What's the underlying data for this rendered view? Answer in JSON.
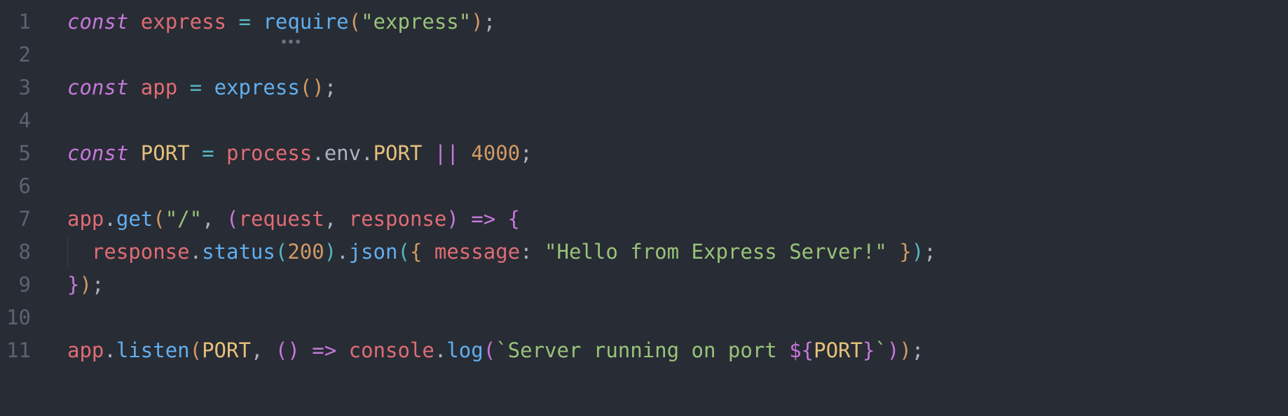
{
  "language": "javascript",
  "syntax_colors": {
    "keyword": "#c678dd",
    "identifier": "#e06c75",
    "definition": "#e5c07b",
    "function": "#61afef",
    "string": "#98c379",
    "number": "#d19a66",
    "operator": "#56b6c2",
    "default": "#abb2bf",
    "comment": "#5c6370",
    "background": "#282c34"
  },
  "gutter": {
    "lines": [
      "1",
      "2",
      "3",
      "4",
      "5",
      "6",
      "7",
      "8",
      "9",
      "10",
      "11"
    ]
  },
  "code": {
    "lines": [
      [
        {
          "cls": "kw-it",
          "t": "const"
        },
        {
          "cls": "plain",
          "t": " "
        },
        {
          "cls": "ident",
          "t": "express"
        },
        {
          "cls": "plain",
          "t": " "
        },
        {
          "cls": "op",
          "t": "="
        },
        {
          "cls": "plain",
          "t": " "
        },
        {
          "cls": "fn",
          "t": "require"
        },
        {
          "cls": "brY",
          "t": "("
        },
        {
          "cls": "str",
          "t": "\"express\""
        },
        {
          "cls": "brY",
          "t": ")"
        },
        {
          "cls": "plain",
          "t": ";"
        }
      ],
      [],
      [
        {
          "cls": "kw-it",
          "t": "const"
        },
        {
          "cls": "plain",
          "t": " "
        },
        {
          "cls": "ident",
          "t": "app"
        },
        {
          "cls": "plain",
          "t": " "
        },
        {
          "cls": "op",
          "t": "="
        },
        {
          "cls": "plain",
          "t": " "
        },
        {
          "cls": "fn",
          "t": "express"
        },
        {
          "cls": "brY",
          "t": "()"
        },
        {
          "cls": "plain",
          "t": ";"
        }
      ],
      [],
      [
        {
          "cls": "kw-it",
          "t": "const"
        },
        {
          "cls": "plain",
          "t": " "
        },
        {
          "cls": "def",
          "t": "PORT"
        },
        {
          "cls": "plain",
          "t": " "
        },
        {
          "cls": "op",
          "t": "="
        },
        {
          "cls": "plain",
          "t": " "
        },
        {
          "cls": "ident",
          "t": "process"
        },
        {
          "cls": "plain",
          "t": "."
        },
        {
          "cls": "prop",
          "t": "env"
        },
        {
          "cls": "plain",
          "t": "."
        },
        {
          "cls": "def",
          "t": "PORT"
        },
        {
          "cls": "plain",
          "t": " "
        },
        {
          "cls": "kw",
          "t": "||"
        },
        {
          "cls": "plain",
          "t": " "
        },
        {
          "cls": "num",
          "t": "4000"
        },
        {
          "cls": "plain",
          "t": ";"
        }
      ],
      [],
      [
        {
          "cls": "ident",
          "t": "app"
        },
        {
          "cls": "plain",
          "t": "."
        },
        {
          "cls": "fn",
          "t": "get"
        },
        {
          "cls": "brY",
          "t": "("
        },
        {
          "cls": "str",
          "t": "\"/\""
        },
        {
          "cls": "plain",
          "t": ", "
        },
        {
          "cls": "brP",
          "t": "("
        },
        {
          "cls": "ident",
          "t": "request"
        },
        {
          "cls": "plain",
          "t": ", "
        },
        {
          "cls": "ident",
          "t": "response"
        },
        {
          "cls": "brP",
          "t": ")"
        },
        {
          "cls": "plain",
          "t": " "
        },
        {
          "cls": "kw",
          "t": "=>"
        },
        {
          "cls": "plain",
          "t": " "
        },
        {
          "cls": "brP",
          "t": "{"
        }
      ],
      [
        {
          "cls": "plain",
          "t": "  "
        },
        {
          "cls": "ident",
          "t": "response"
        },
        {
          "cls": "plain",
          "t": "."
        },
        {
          "cls": "fn",
          "t": "status"
        },
        {
          "cls": "brB",
          "t": "("
        },
        {
          "cls": "num",
          "t": "200"
        },
        {
          "cls": "brB",
          "t": ")"
        },
        {
          "cls": "plain",
          "t": "."
        },
        {
          "cls": "fn",
          "t": "json"
        },
        {
          "cls": "brB",
          "t": "("
        },
        {
          "cls": "brY",
          "t": "{"
        },
        {
          "cls": "plain",
          "t": " "
        },
        {
          "cls": "ident",
          "t": "message"
        },
        {
          "cls": "plain",
          "t": ": "
        },
        {
          "cls": "str",
          "t": "\"Hello from Express Server!\""
        },
        {
          "cls": "plain",
          "t": " "
        },
        {
          "cls": "brY",
          "t": "}"
        },
        {
          "cls": "brB",
          "t": ")"
        },
        {
          "cls": "plain",
          "t": ";"
        }
      ],
      [
        {
          "cls": "brP",
          "t": "}"
        },
        {
          "cls": "brY",
          "t": ")"
        },
        {
          "cls": "plain",
          "t": ";"
        }
      ],
      [],
      [
        {
          "cls": "ident",
          "t": "app"
        },
        {
          "cls": "plain",
          "t": "."
        },
        {
          "cls": "fn",
          "t": "listen"
        },
        {
          "cls": "brY",
          "t": "("
        },
        {
          "cls": "def",
          "t": "PORT"
        },
        {
          "cls": "plain",
          "t": ", "
        },
        {
          "cls": "brP",
          "t": "()"
        },
        {
          "cls": "plain",
          "t": " "
        },
        {
          "cls": "kw",
          "t": "=>"
        },
        {
          "cls": "plain",
          "t": " "
        },
        {
          "cls": "ident",
          "t": "console"
        },
        {
          "cls": "plain",
          "t": "."
        },
        {
          "cls": "fn",
          "t": "log"
        },
        {
          "cls": "brP",
          "t": "("
        },
        {
          "cls": "tmpl",
          "t": "`Server running on port "
        },
        {
          "cls": "kw",
          "t": "${"
        },
        {
          "cls": "def",
          "t": "PORT"
        },
        {
          "cls": "kw",
          "t": "}"
        },
        {
          "cls": "tmpl",
          "t": "`"
        },
        {
          "cls": "brP",
          "t": ")"
        },
        {
          "cls": "brY",
          "t": ")"
        },
        {
          "cls": "plain",
          "t": ";"
        }
      ]
    ]
  },
  "hint": {
    "dots": "•••",
    "line": 1
  }
}
